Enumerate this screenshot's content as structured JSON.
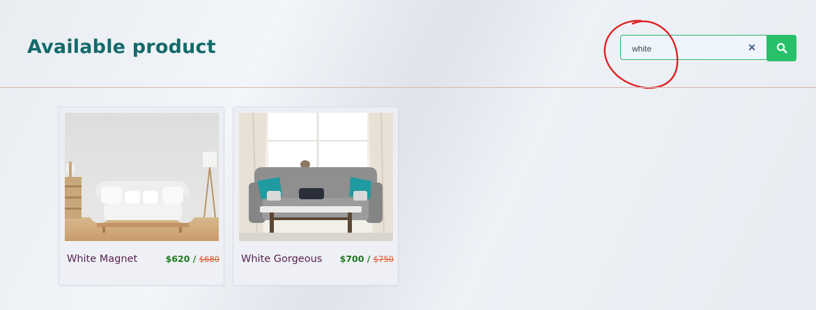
{
  "header": {
    "title": "Available product"
  },
  "search": {
    "value": "white",
    "placeholder": "",
    "clear_icon": "close-icon",
    "button_icon": "search-icon"
  },
  "colors": {
    "title": "#146a6a",
    "accent": "#28c16a",
    "annotation": "#e02020",
    "product_name": "#5a2250",
    "price": "#1d7a1d",
    "old_price": "#e0562a"
  },
  "products": [
    {
      "name": "White Magnet",
      "price": "$620",
      "separator": " / ",
      "old_price": "$680"
    },
    {
      "name": "White Gorgeous",
      "price": "$700",
      "separator": " / ",
      "old_price": "$750"
    }
  ]
}
